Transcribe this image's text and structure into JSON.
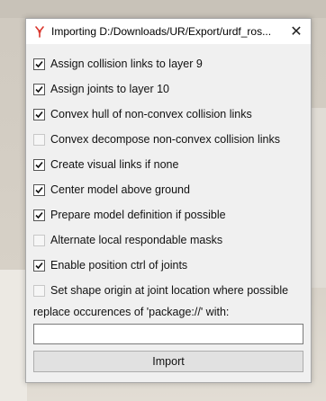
{
  "window": {
    "title": "Importing D:/Downloads/UR/Export/urdf_ros...",
    "app_icon": "robot-arm-icon",
    "close_glyph": "✕"
  },
  "options": [
    {
      "label": "Assign collision links to layer 9",
      "checked": true
    },
    {
      "label": "Assign joints to layer 10",
      "checked": true
    },
    {
      "label": "Convex hull of non-convex collision links",
      "checked": true
    },
    {
      "label": "Convex decompose non-convex collision links",
      "checked": false
    },
    {
      "label": "Create visual links if none",
      "checked": true
    },
    {
      "label": "Center model above ground",
      "checked": true
    },
    {
      "label": "Prepare model definition if possible",
      "checked": true
    },
    {
      "label": "Alternate local respondable masks",
      "checked": false
    },
    {
      "label": "Enable position ctrl of joints",
      "checked": true
    },
    {
      "label": "Set shape origin at joint location where possible",
      "checked": false
    }
  ],
  "replace": {
    "label": "replace occurences of 'package://' with:",
    "value": ""
  },
  "import_button": {
    "label": "Import"
  },
  "colors": {
    "dialog_bg": "#f0f0f0",
    "titlebar_bg": "#ffffff",
    "button_bg": "#e1e1e1",
    "icon_red": "#d9342b"
  }
}
